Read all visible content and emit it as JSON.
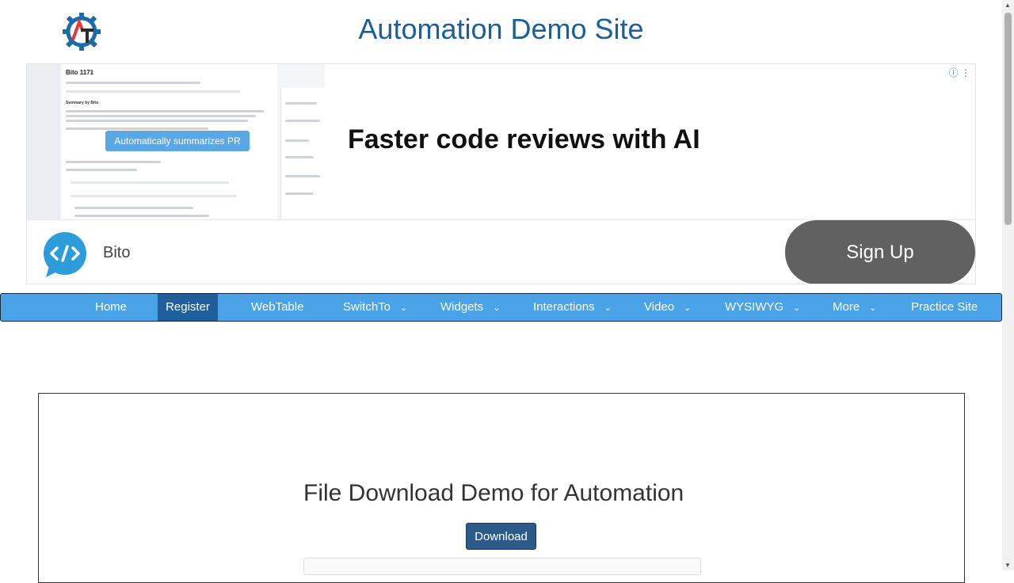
{
  "header": {
    "title": "Automation Demo Site",
    "logo_icon": "gear-at-logo-icon"
  },
  "ad": {
    "headline": "Faster code reviews with AI",
    "tooltip": "Automatically summarizes PR",
    "screenshot_title": "Bito 1171",
    "screenshot_section": "Summary by Bito",
    "advertiser": "Bito",
    "cta": "Sign Up",
    "info_icon": "ⓘ",
    "menu_icon": "⋮",
    "brand_color": "#2d9cdb"
  },
  "nav": {
    "items": [
      {
        "label": "Home",
        "caret": false
      },
      {
        "label": "Register",
        "caret": false,
        "active": true
      },
      {
        "label": "WebTable",
        "caret": false
      },
      {
        "label": "SwitchTo",
        "caret": true
      },
      {
        "label": "Widgets",
        "caret": true
      },
      {
        "label": "Interactions",
        "caret": true
      },
      {
        "label": "Video",
        "caret": true
      },
      {
        "label": "WYSIWYG",
        "caret": true
      },
      {
        "label": "More",
        "caret": true
      },
      {
        "label": "Practice Site",
        "caret": false
      }
    ],
    "bg_color": "#4aa3e6",
    "active_color": "#1e5f9c"
  },
  "main": {
    "title": "File Download Demo for Automation",
    "download_button": "Download"
  }
}
